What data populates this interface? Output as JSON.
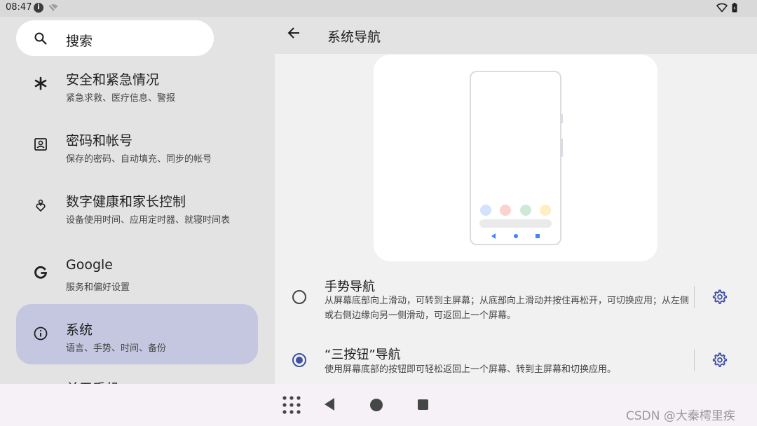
{
  "status_bar": {
    "time": "08:47",
    "icons": [
      "info-icon",
      "wifi-off-icon",
      "wifi-icon",
      "battery-icon"
    ]
  },
  "search": {
    "label": "搜索"
  },
  "menu": {
    "items": [
      {
        "title": "安全和紧急情况",
        "subtitle": "紧急求救、医疗信息、警报",
        "icon": "asterisk-icon"
      },
      {
        "title": "密码和帐号",
        "subtitle": "保存的密码、自动填充、同步的帐号",
        "icon": "account-box-icon"
      },
      {
        "title": "数字健康和家长控制",
        "subtitle": "设备使用时间、应用定时器、就寝时间表",
        "icon": "digital-wellbeing-icon"
      },
      {
        "title": "Google",
        "subtitle": "服务和偏好设置",
        "icon": "google-icon"
      },
      {
        "title": "系统",
        "subtitle": "语言、手势、时间、备份",
        "icon": "info-icon",
        "selected": true
      }
    ],
    "cutoff_item_title": "关于手机"
  },
  "detail": {
    "title": "系统导航",
    "preview_dot_colors": [
      "#d2e3fc",
      "#fad2cf",
      "#ceead6",
      "#feefc3"
    ],
    "options": [
      {
        "title": "手势导航",
        "description": "从屏幕底部向上滑动，可转到主屏幕；从底部向上滑动并按住再松开，可切换应用；从左侧或右侧边缘向另一侧滑动，可返回上一个屏幕。",
        "selected": false
      },
      {
        "title": "“三按钮”导航",
        "description": "使用屏幕底部的按钮即可轻松返回上一个屏幕、转到主屏幕和切换应用。",
        "selected": true
      }
    ]
  },
  "nav_bar": {
    "buttons": [
      "apps",
      "back",
      "home",
      "recents"
    ]
  },
  "watermark": "CSDN @大秦樗里疾",
  "colors": {
    "accent": "#3f51a3",
    "selected_item_bg": "#c4c7df",
    "panel_bg": "#e3e3e3",
    "detail_bg": "#f1f1f1"
  }
}
